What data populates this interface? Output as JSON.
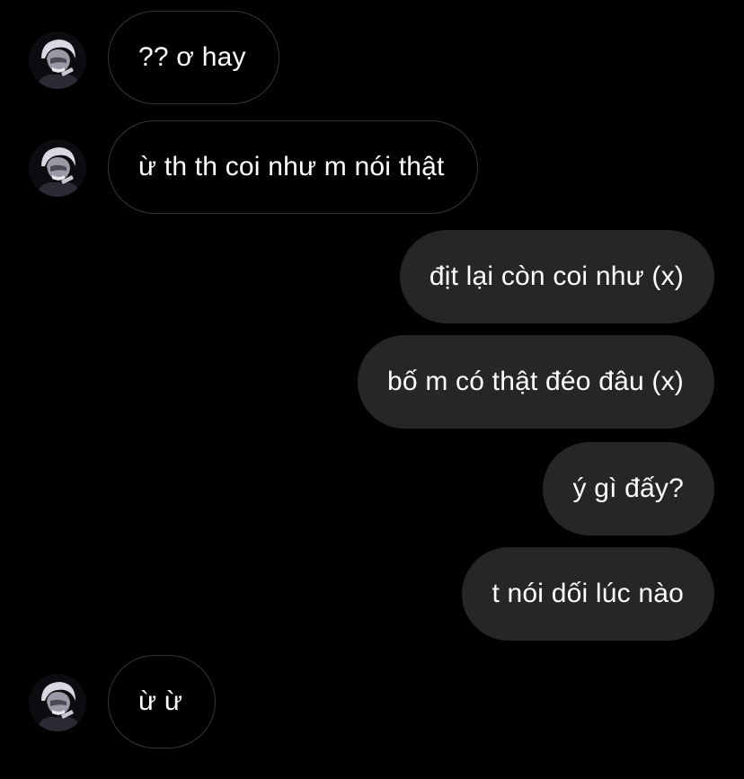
{
  "messages": [
    {
      "sender": "them",
      "text": "?? ơ hay"
    },
    {
      "sender": "them",
      "text": "ừ th th coi như m nói thật"
    },
    {
      "sender": "me",
      "text": "địt lại còn coi như (x)"
    },
    {
      "sender": "me",
      "text": "bố m có thật đéo đâu (x)"
    },
    {
      "sender": "me",
      "text": "ý gì đấy?"
    },
    {
      "sender": "me",
      "text": "t nói dối lúc nào"
    },
    {
      "sender": "them",
      "text": "ừ ừ"
    }
  ],
  "colors": {
    "background": "#000000",
    "incoming_border": "#363636",
    "outgoing_bubble": "#262626",
    "text": "#ffffff"
  },
  "icons": {
    "avatar": "contact-avatar-icon"
  }
}
